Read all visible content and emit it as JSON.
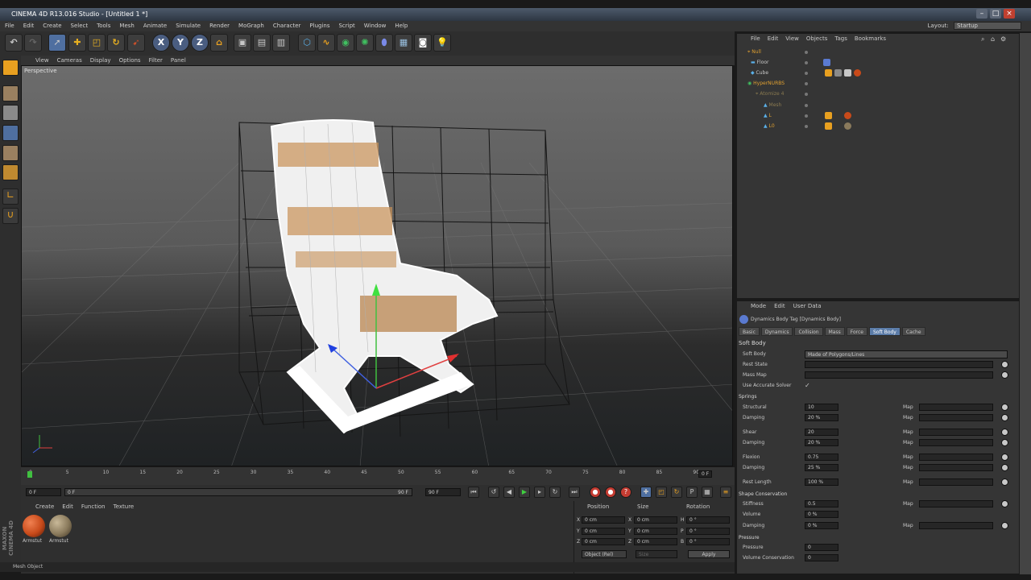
{
  "window": {
    "title": "CINEMA 4D R13.016 Studio - [Untitled 1 *]",
    "layout_label": "Layout:",
    "layout_value": "Startup"
  },
  "menu": [
    "File",
    "Edit",
    "Create",
    "Select",
    "Tools",
    "Mesh",
    "Animate",
    "Simulate",
    "Render",
    "MoGraph",
    "Character",
    "Plugins",
    "Script",
    "Window",
    "Help"
  ],
  "toolbar": {
    "axis_x": "X",
    "axis_y": "Y",
    "axis_z": "Z"
  },
  "viewport": {
    "menu": [
      "View",
      "Cameras",
      "Display",
      "Options",
      "Filter",
      "Panel"
    ],
    "label": "Perspective"
  },
  "timeline": {
    "ticks": [
      "0",
      "5",
      "10",
      "15",
      "20",
      "25",
      "30",
      "35",
      "40",
      "45",
      "50",
      "55",
      "60",
      "65",
      "70",
      "75",
      "80",
      "85",
      "90"
    ],
    "end_frame": "0 F",
    "start_field": "0 F",
    "slider_left": "0 F",
    "slider_right": "90 F",
    "end_field": "90 F"
  },
  "materials": {
    "menu": [
      "Create",
      "Edit",
      "Function",
      "Texture"
    ],
    "items": [
      {
        "name": "Armstut",
        "color": "#c84a1a"
      },
      {
        "name": "Armstut",
        "color": "#8a7a5c"
      }
    ]
  },
  "coords": {
    "headers": [
      "Position",
      "Size",
      "Rotation"
    ],
    "rows": [
      {
        "axis": "X",
        "pos": "0 cm",
        "saxis": "X",
        "size": "0 cm",
        "raxis": "H",
        "rot": "0 °"
      },
      {
        "axis": "Y",
        "pos": "0 cm",
        "saxis": "Y",
        "size": "0 cm",
        "raxis": "P",
        "rot": "0 °"
      },
      {
        "axis": "Z",
        "pos": "0 cm",
        "saxis": "Z",
        "size": "0 cm",
        "raxis": "B",
        "rot": "0 °"
      }
    ],
    "mode": "Object (Rel)",
    "size_mode": "Size",
    "apply": "Apply"
  },
  "status": "Mesh Object",
  "brand": "MAXON CINEMA 4D",
  "objects": {
    "menu": [
      "File",
      "Edit",
      "View",
      "Objects",
      "Tags",
      "Bookmarks"
    ],
    "tree": [
      {
        "name": "Null",
        "color": "#e0a030"
      },
      {
        "name": "Floor",
        "color": "#c8c8c8"
      },
      {
        "name": "Cube",
        "color": "#c8c8c8"
      },
      {
        "name": "HyperNURBS",
        "color": "#e0a030"
      },
      {
        "name": "Atomize 4",
        "color": "#8a7a50"
      },
      {
        "name": "Mesh",
        "color": "#8a7a50"
      },
      {
        "name": "L",
        "color": "#e0a030"
      },
      {
        "name": "L0",
        "color": "#e0a030"
      }
    ]
  },
  "attributes": {
    "menu": [
      "Mode",
      "Edit",
      "User Data"
    ],
    "title": "Dynamics Body Tag [Dynamics Body]",
    "tabs": [
      "Basic",
      "Dynamics",
      "Collision",
      "Mass",
      "Force",
      "Soft Body",
      "Cache"
    ],
    "section": "Soft Body",
    "soft_body_label": "Soft Body",
    "soft_body_value": "Made of Polygons/Lines",
    "rest_state": "Rest State",
    "mass_map": "Mass Map",
    "accurate": "Use Accurate Solver",
    "springs": "Springs",
    "structural": {
      "label": "Structural",
      "value": "10"
    },
    "s_damping": {
      "label": "Damping",
      "value": "20 %"
    },
    "shear": {
      "label": "Shear",
      "value": "20"
    },
    "sh_damping": {
      "label": "Damping",
      "value": "20 %"
    },
    "flexion": {
      "label": "Flexion",
      "value": "0.75"
    },
    "f_damping": {
      "label": "Damping",
      "value": "25 %"
    },
    "rest_length": {
      "label": "Rest Length",
      "value": "100 %"
    },
    "shape": "Shape Conservation",
    "stiffness": {
      "label": "Stiffness",
      "value": "0.5"
    },
    "volume": {
      "label": "Volume",
      "value": "0 %"
    },
    "sc_damping": {
      "label": "Damping",
      "value": "0 %"
    },
    "pressure_head": "Pressure",
    "pressure": {
      "label": "Pressure",
      "value": "0"
    },
    "vol_cons": {
      "label": "Volume Conservation",
      "value": "0"
    },
    "map_label": "Map"
  }
}
